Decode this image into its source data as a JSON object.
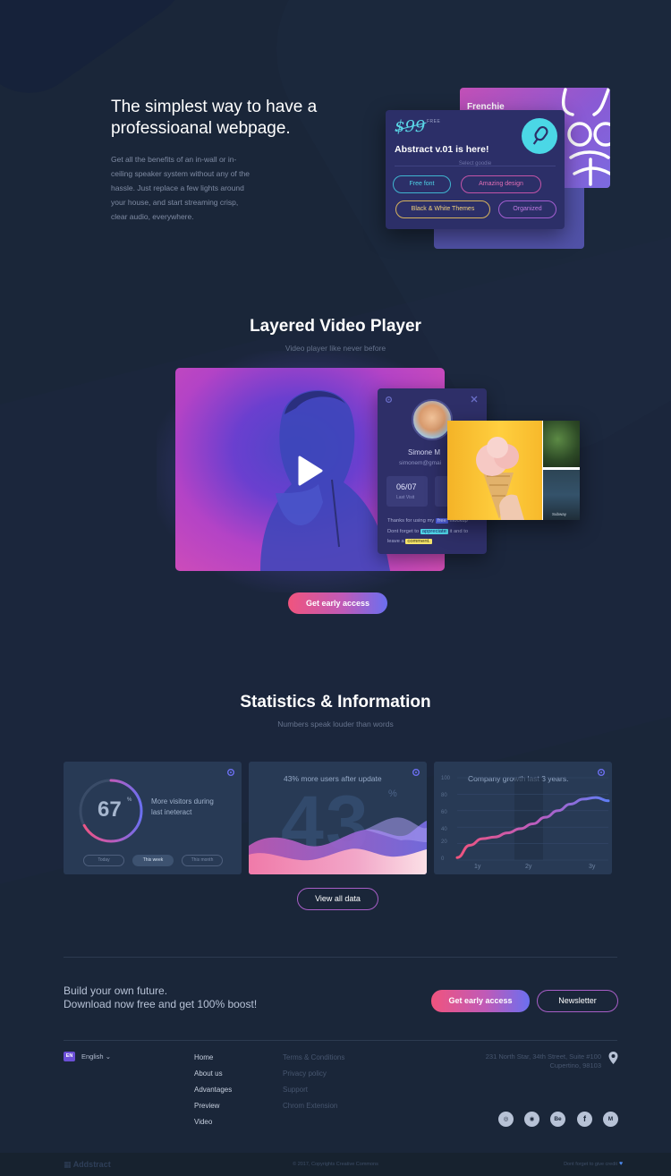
{
  "hero": {
    "title": "The simplest way to have a professioanal webpage.",
    "description": "Get all the benefits of an in-wall or in-ceiling speaker system without any of the hassle. Just replace a few lights around your house, and start streaming crisp, clear audio, everywhere."
  },
  "promo_card": {
    "back_label": "Frenchie",
    "price": "$99",
    "price_tag": "FREE",
    "title": "Abstract v.01 is here!",
    "subtitle": "Select goodie",
    "chips": [
      "Free font",
      "Amazing design",
      "Black & White Themes",
      "Organized"
    ]
  },
  "video_section": {
    "title": "Layered Video Player",
    "subtitle": "Video player like never before",
    "profile": {
      "name": "Simone M",
      "email": "simonem@gmai",
      "stat_value": "06/07",
      "stat_label": "Last Visit",
      "note1_pre": "Thanks for using my",
      "note1_tag": "free",
      "note1_post": "mockup",
      "note2_pre": "Dont forget to",
      "note2_tag": "appreciate",
      "note2_post": "it and to",
      "note3_pre": "leave a",
      "note3_tag": "comment."
    },
    "gallery_caption": "Subway",
    "cta": "Get early access"
  },
  "stats_section": {
    "title": "Statistics & Information",
    "subtitle": "Numbers speak louder than words",
    "card1": {
      "value": "67",
      "unit": "%",
      "text": "More visitors during last ineteract",
      "tabs": [
        "Today",
        "This week",
        "This month"
      ],
      "active_tab": "This week"
    },
    "card2": {
      "caption": "43% more users after update",
      "big": "43",
      "unit": "%"
    },
    "card3": {
      "caption": "Company growth last 3 years.",
      "y_ticks": [
        "100",
        "80",
        "60",
        "40",
        "20",
        "0"
      ],
      "x_ticks": [
        "1y",
        "2y",
        "3y"
      ]
    },
    "view_all": "View all data"
  },
  "cta_section": {
    "line1": "Build your own future.",
    "line2": "Download now free and get 100% boost!",
    "primary": "Get early access",
    "secondary": "Newsletter"
  },
  "footer": {
    "lang_code": "EN",
    "lang_label": "English",
    "nav": [
      "Home",
      "About us",
      "Advantages",
      "Preview",
      "Video"
    ],
    "legal": [
      "Terms & Conditions",
      "Privacy policy",
      "Support",
      "Chrom Extension"
    ],
    "address_line1": "231 North Star, 34th Street, Suite #100",
    "address_line2": "Cupertino, 98103",
    "socials": [
      "dribbble",
      "instagram",
      "Be",
      "f",
      "M"
    ],
    "logo": "Addstract",
    "copyright": "© 2017, Copyrights Creative Commons",
    "credit": "Dont forget to give credit"
  },
  "chart_data": [
    {
      "type": "area",
      "title": "43% more users after update",
      "series": [],
      "note": ""
    },
    {
      "type": "line",
      "title": "Company growth last 3 years.",
      "categories": [
        "1y",
        "2y",
        "3y"
      ],
      "x": [
        0,
        0.25,
        0.5,
        0.75,
        1.0,
        1.25,
        1.5,
        1.75,
        2.0,
        2.25,
        2.5,
        2.75,
        3.0
      ],
      "values": [
        3,
        18,
        26,
        28,
        33,
        38,
        44,
        52,
        60,
        68,
        74,
        76,
        72
      ],
      "ylim": [
        0,
        100
      ],
      "yticks": [
        0,
        20,
        40,
        60,
        80,
        100
      ],
      "grid": true
    }
  ]
}
